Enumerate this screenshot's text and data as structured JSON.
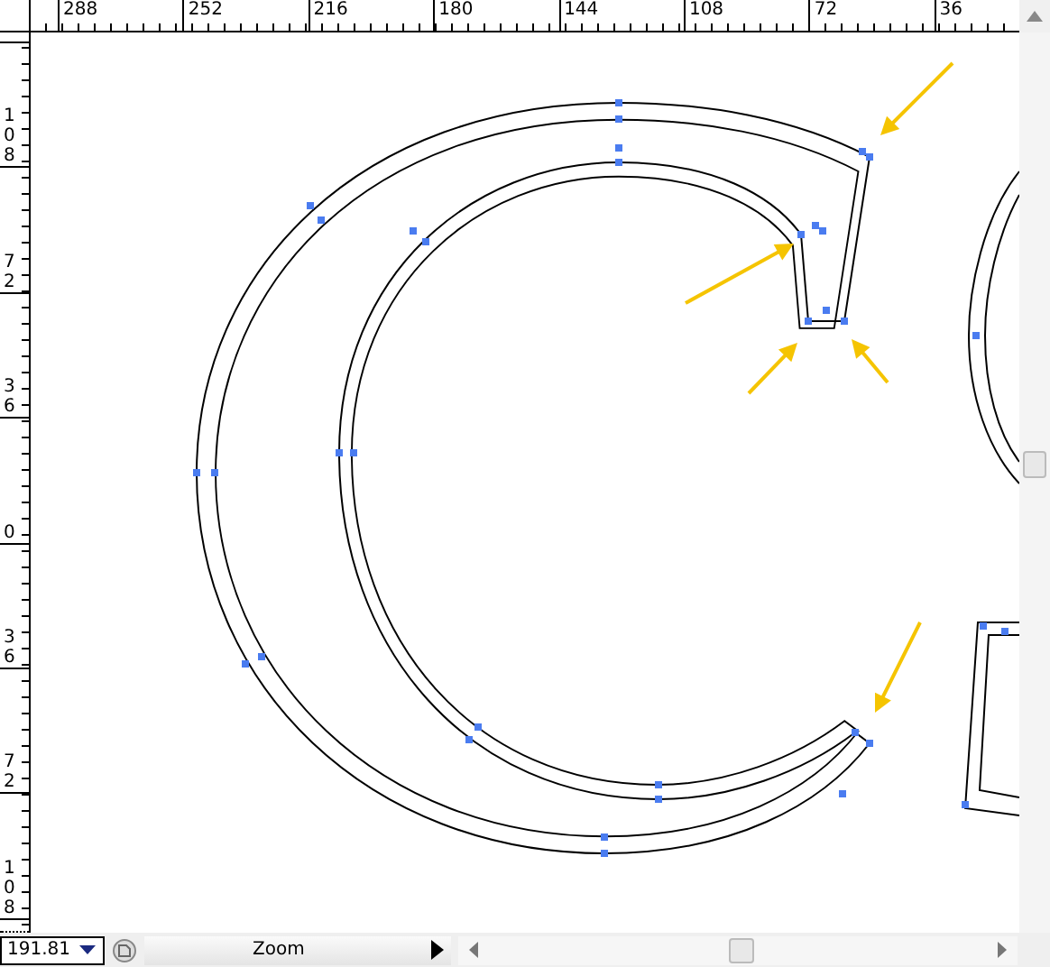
{
  "rulers": {
    "horizontal": [
      "288",
      "252",
      "216",
      "180",
      "144",
      "108",
      "72",
      "36"
    ],
    "vertical": [
      "108",
      "72",
      "36",
      "0",
      "36",
      "72",
      "108"
    ]
  },
  "zoom_field": {
    "value": "191.81"
  },
  "status_bar": {
    "label": "Zoom"
  }
}
